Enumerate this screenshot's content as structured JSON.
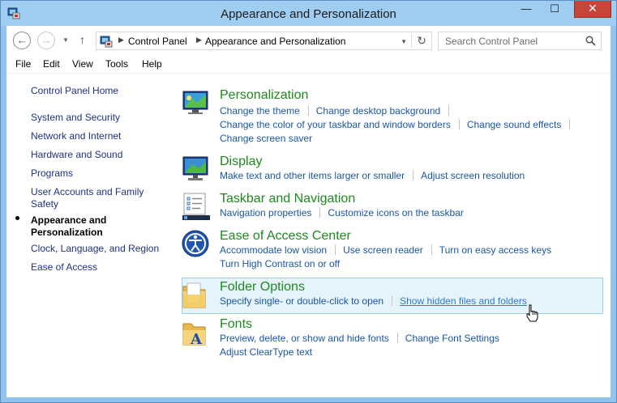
{
  "window": {
    "title": "Appearance and Personalization",
    "close_label": "✕",
    "minimize_label": "—",
    "maximize_label": "☐"
  },
  "address": {
    "crumbs": [
      "Control Panel",
      "Appearance and Personalization"
    ],
    "search_placeholder": "Search Control Panel"
  },
  "menu": [
    "File",
    "Edit",
    "View",
    "Tools",
    "Help"
  ],
  "sidebar": {
    "home": "Control Panel Home",
    "items": [
      "System and Security",
      "Network and Internet",
      "Hardware and Sound",
      "Programs",
      "User Accounts and Family Safety",
      "Appearance and Personalization",
      "Clock, Language, and Region",
      "Ease of Access"
    ],
    "active_index": 5
  },
  "categories": [
    {
      "title": "Personalization",
      "icon": "personalization-icon",
      "lines": [
        [
          "Change the theme",
          "Change desktop background"
        ],
        [
          "Change the color of your taskbar and window borders",
          "Change sound effects"
        ],
        [
          "Change screen saver"
        ]
      ]
    },
    {
      "title": "Display",
      "icon": "display-icon",
      "lines": [
        [
          "Make text and other items larger or smaller",
          "Adjust screen resolution"
        ]
      ]
    },
    {
      "title": "Taskbar and Navigation",
      "icon": "taskbar-icon",
      "lines": [
        [
          "Navigation properties",
          "Customize icons on the taskbar"
        ]
      ]
    },
    {
      "title": "Ease of Access Center",
      "icon": "ease-of-access-icon",
      "lines": [
        [
          "Accommodate low vision",
          "Use screen reader",
          "Turn on easy access keys"
        ],
        [
          "Turn High Contrast on or off"
        ]
      ]
    },
    {
      "title": "Folder Options",
      "icon": "folder-icon",
      "lines": [
        [
          "Specify single- or double-click to open",
          "Show hidden files and folders"
        ]
      ]
    },
    {
      "title": "Fonts",
      "icon": "fonts-folder-icon",
      "lines": [
        [
          "Preview, delete, or show and hide fonts",
          "Change Font Settings"
        ],
        [
          "Adjust ClearType text"
        ]
      ]
    }
  ],
  "colors": {
    "link": "#1a56a8",
    "category_title": "#1e8a1e",
    "sidebar_link": "#1e3287",
    "highlight_bg": "#e5f3fb"
  }
}
